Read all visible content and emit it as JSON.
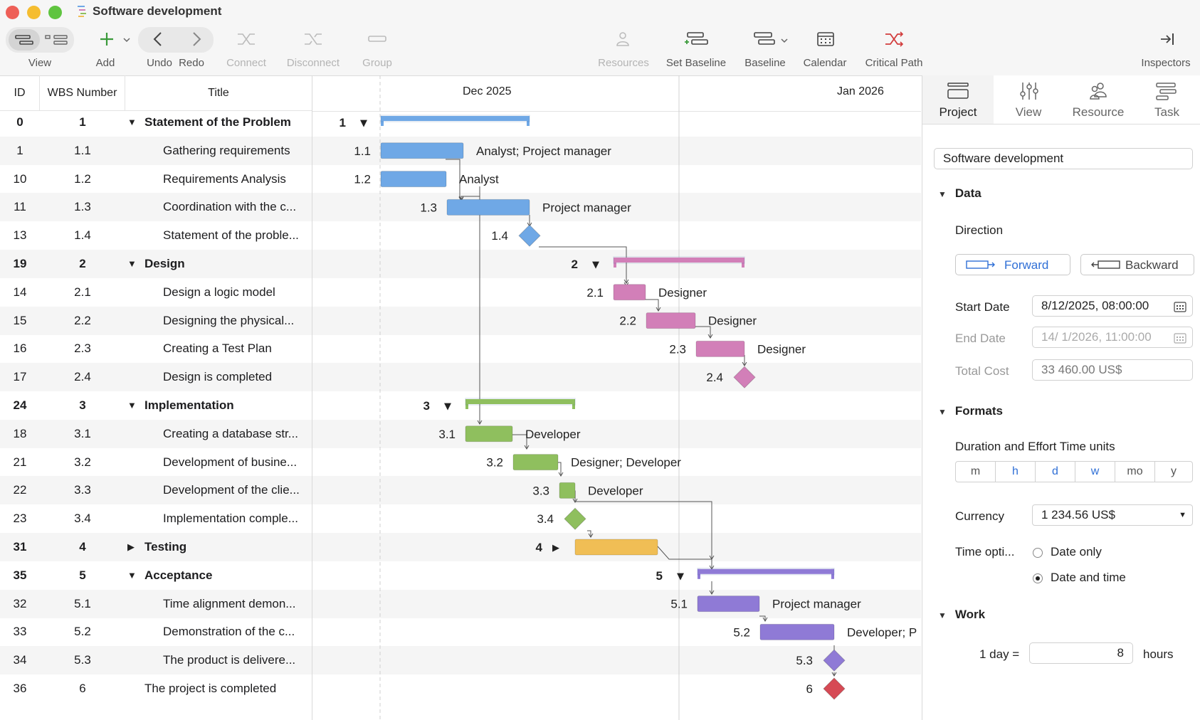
{
  "window": {
    "title": "Software development"
  },
  "toolbar": {
    "view": "View",
    "add": "Add",
    "undo": "Undo",
    "redo": "Redo",
    "connect": "Connect",
    "disconnect": "Disconnect",
    "group": "Group",
    "resources": "Resources",
    "set_baseline": "Set Baseline",
    "baseline": "Baseline",
    "calendar": "Calendar",
    "critical_path": "Critical Path",
    "inspectors": "Inspectors"
  },
  "table": {
    "headers": {
      "id": "ID",
      "wbs": "WBS Number",
      "title": "Title"
    },
    "rows": [
      {
        "id": "0",
        "wbs": "1",
        "title": "Statement of the Problem",
        "summary": true,
        "expanded": true
      },
      {
        "id": "1",
        "wbs": "1.1",
        "title": "Gathering requirements"
      },
      {
        "id": "10",
        "wbs": "1.2",
        "title": "Requirements Analysis"
      },
      {
        "id": "11",
        "wbs": "1.3",
        "title": "Coordination with the c..."
      },
      {
        "id": "13",
        "wbs": "1.4",
        "title": "Statement of the proble..."
      },
      {
        "id": "19",
        "wbs": "2",
        "title": "Design",
        "summary": true,
        "expanded": true
      },
      {
        "id": "14",
        "wbs": "2.1",
        "title": "Design a logic model"
      },
      {
        "id": "15",
        "wbs": "2.2",
        "title": "Designing the physical..."
      },
      {
        "id": "16",
        "wbs": "2.3",
        "title": "Creating a Test Plan"
      },
      {
        "id": "17",
        "wbs": "2.4",
        "title": "Design is completed"
      },
      {
        "id": "24",
        "wbs": "3",
        "title": "Implementation",
        "summary": true,
        "expanded": true
      },
      {
        "id": "18",
        "wbs": "3.1",
        "title": "Creating a database str..."
      },
      {
        "id": "21",
        "wbs": "3.2",
        "title": "Development of busine..."
      },
      {
        "id": "22",
        "wbs": "3.3",
        "title": "Development of the clie..."
      },
      {
        "id": "23",
        "wbs": "3.4",
        "title": "Implementation comple..."
      },
      {
        "id": "31",
        "wbs": "4",
        "title": "Testing",
        "summary": true,
        "expanded": false
      },
      {
        "id": "35",
        "wbs": "5",
        "title": "Acceptance",
        "summary": true,
        "expanded": true
      },
      {
        "id": "32",
        "wbs": "5.1",
        "title": "Time alignment demon..."
      },
      {
        "id": "33",
        "wbs": "5.2",
        "title": "Demonstration of the c..."
      },
      {
        "id": "34",
        "wbs": "5.3",
        "title": "The product is delivere..."
      },
      {
        "id": "36",
        "wbs": "6",
        "title": "The project is completed",
        "toplevel": true
      }
    ]
  },
  "gantt": {
    "months": [
      "Dec 2025",
      "Jan 2026"
    ],
    "colors": {
      "phase1": "#6fa8e6",
      "phase2": "#d27fb8",
      "phase3": "#8fbf5e",
      "phase4": "#f0be55",
      "phase5": "#8f7ad6",
      "final": "#d64a55"
    },
    "resources": {
      "1.1": "Analyst; Project manager",
      "1.2": "Analyst",
      "1.3": "Project manager",
      "2.1": "Designer",
      "2.2": "Designer",
      "2.3": "Designer",
      "3.1": "Developer",
      "3.2": "Designer; Developer",
      "3.3": "Developer",
      "5.1": "Project manager",
      "5.2": "Developer; P"
    }
  },
  "inspector": {
    "tabs": [
      "Project",
      "View",
      "Resource",
      "Task"
    ],
    "project_name": "Software development",
    "data_section": "Data",
    "direction_label": "Direction",
    "forward": "Forward",
    "backward": "Backward",
    "start_date_label": "Start Date",
    "start_date": "8/12/2025, 08:00:00",
    "end_date_label": "End Date",
    "end_date": "14/  1/2026, 11:00:00",
    "total_cost_label": "Total Cost",
    "total_cost": "33 460.00 US$",
    "formats_section": "Formats",
    "time_units_label": "Duration and Effort Time units",
    "time_units": [
      "m",
      "h",
      "d",
      "w",
      "mo",
      "y"
    ],
    "currency_label": "Currency",
    "currency": "1 234.56 US$",
    "time_options_label": "Time opti...",
    "date_only": "Date only",
    "date_and_time": "Date and time",
    "work_section": "Work",
    "day_eq": "1 day =",
    "hours_value": "8",
    "hours": "hours"
  }
}
